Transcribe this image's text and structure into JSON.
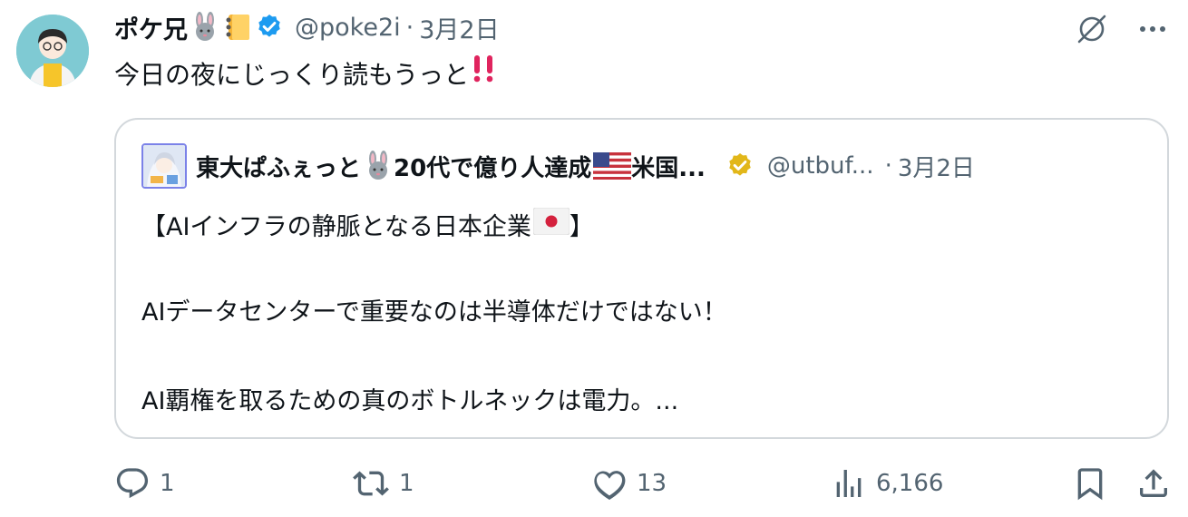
{
  "tweet": {
    "author_name": "ポケ兄",
    "author_emojis": [
      "rabbit-face",
      "notebook"
    ],
    "verified_color": "#1d9bf0",
    "handle": "@poke2i",
    "separator": "·",
    "date": "3月2日",
    "text": "今日の夜にじっくり読もうっと",
    "text_emoji": "double-exclamation-mark"
  },
  "quote": {
    "author_name_a": "東大ぱふぇっと",
    "author_name_b": "20代で億り人達成",
    "author_name_c": "米国...",
    "author_emojis": [
      "rabbit-face",
      "us-flag"
    ],
    "verified_color": "#e2b719",
    "handle": "@utbuf...",
    "separator": "·",
    "date": "3月2日",
    "line1_a": "【AIインフラの静脈となる日本企業",
    "line1_b": "】",
    "line1_emoji": "japan-flag",
    "line2": "AIデータセンターで重要なのは半導体だけではない！",
    "line3": "AI覇権を取るための真のボトルネックは電力。..."
  },
  "actions": {
    "replies": "1",
    "retweets": "1",
    "likes": "13",
    "views": "6,166"
  },
  "icons": [
    "grok-icon",
    "more-icon",
    "reply-icon",
    "retweet-icon",
    "like-icon",
    "views-icon",
    "bookmark-icon",
    "share-icon"
  ],
  "colors": {
    "text": "#0f1419",
    "muted": "#536471",
    "border": "#d3d8dc",
    "alert_red": "#e0245e"
  }
}
